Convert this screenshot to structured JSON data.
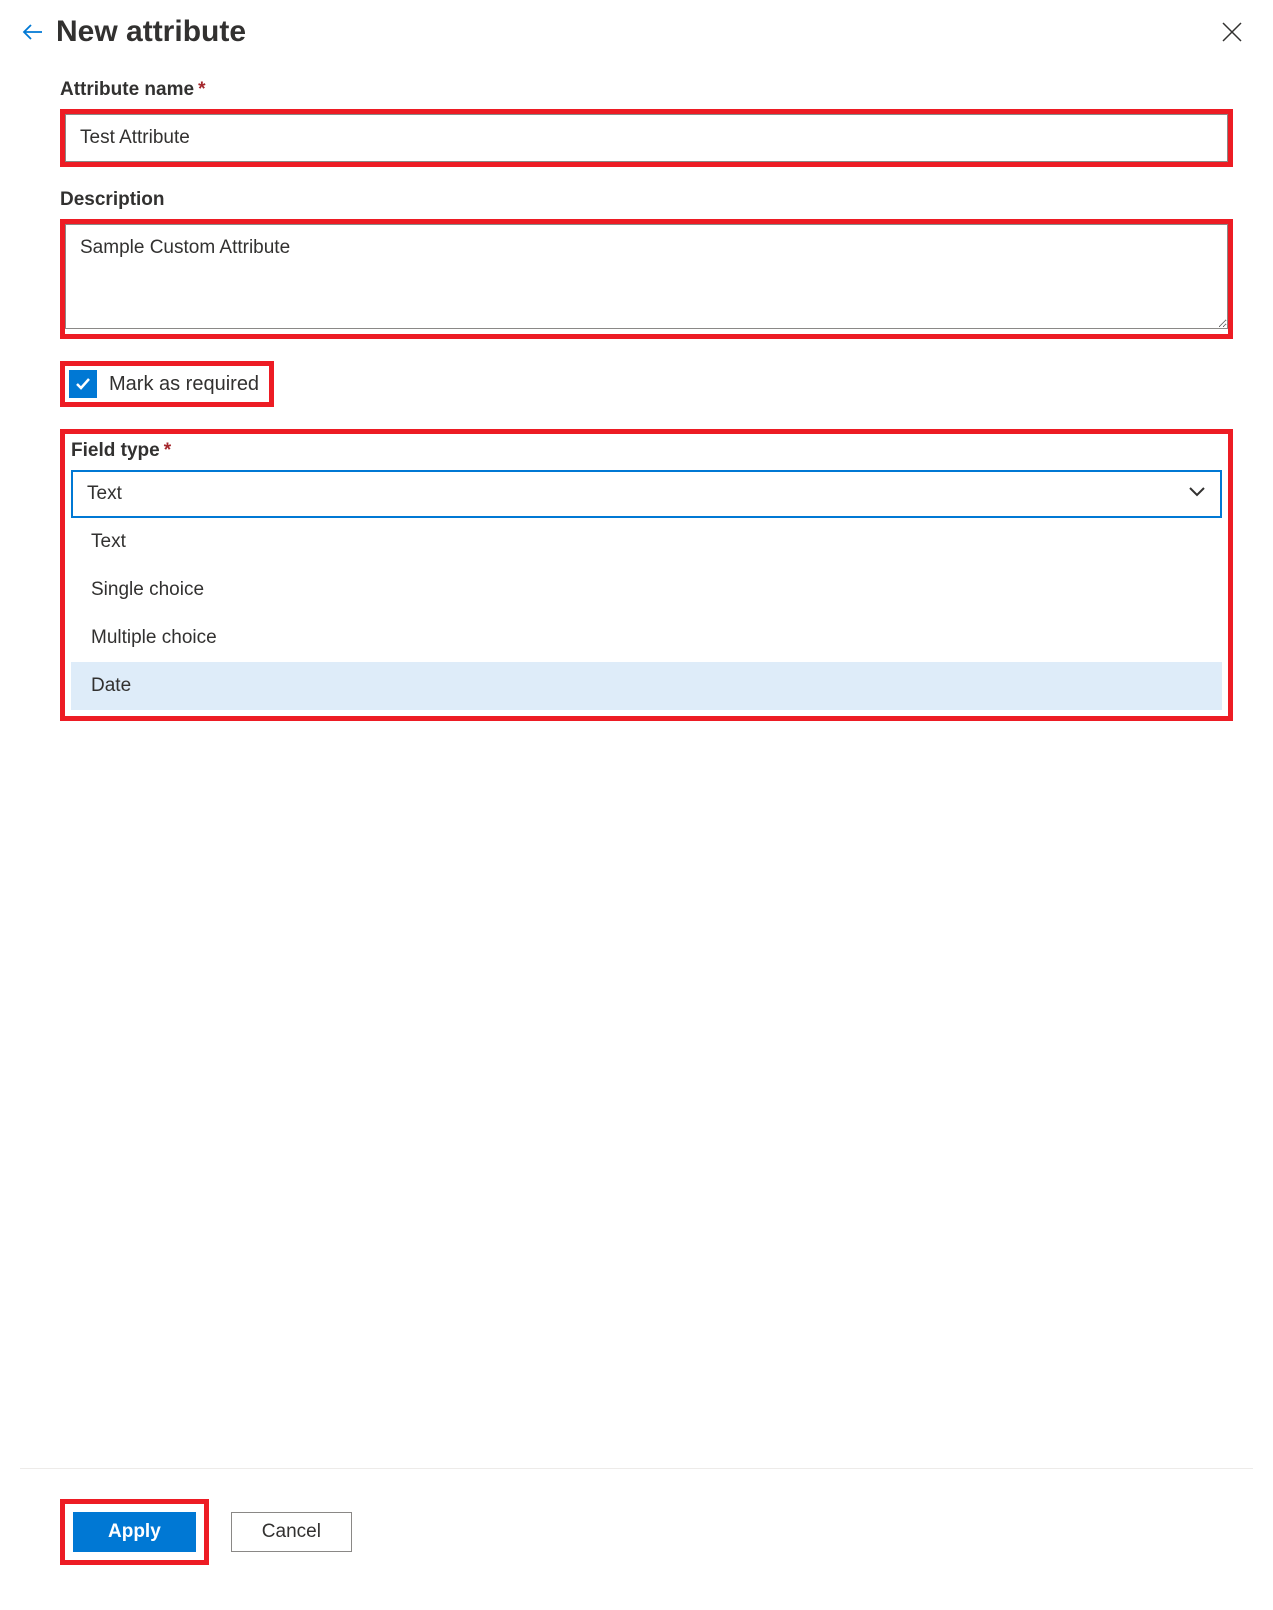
{
  "header": {
    "title": "New attribute"
  },
  "form": {
    "attribute_name": {
      "label": "Attribute name",
      "value": "Test Attribute",
      "required": true
    },
    "description": {
      "label": "Description",
      "value": "Sample Custom Attribute"
    },
    "mark_required": {
      "label": "Mark as required",
      "checked": true
    },
    "field_type": {
      "label": "Field type",
      "required": true,
      "selected": "Text",
      "options": [
        "Text",
        "Single choice",
        "Multiple choice",
        "Date"
      ],
      "highlighted_option": "Date"
    }
  },
  "footer": {
    "apply": "Apply",
    "cancel": "Cancel"
  }
}
